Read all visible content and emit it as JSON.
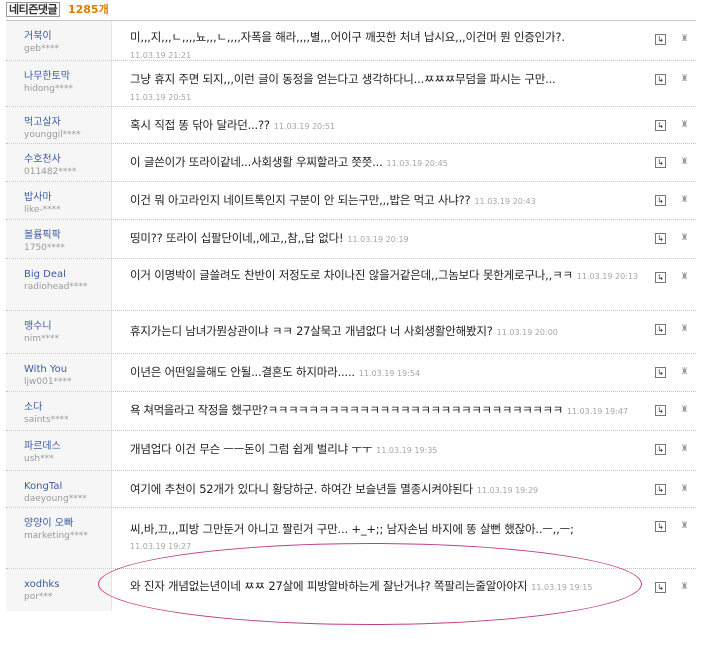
{
  "header": {
    "title": "네티즌댓글",
    "count": "1285개"
  },
  "icons": {
    "reply": "reply-arrow-icon",
    "report": "siren-bell-icon"
  },
  "colors": {
    "highlight_ellipse": "#c23d88",
    "count": "#e07b00",
    "nickname": "#3b5b9f"
  },
  "comments": [
    {
      "nick": "거북이",
      "id": "geb****",
      "text": "미,,,지,,,ㄴ,,,,뇨,,,ㄴ,,,,자폭을 해라,,,,별,,,어이구 깨끗한 처녀 납시요,,,이건머 뭔 인증인가?.",
      "date": "11.03.19 21:21"
    },
    {
      "nick": "나무한토막",
      "id": "hidong****",
      "text": "그냥 휴지 주면 되지,,,이런 글이 동정을 얻는다고 생각하다니...ㅉㅉㅉ무덤을 파시는 구만...",
      "date": "11.03.19 20:51"
    },
    {
      "nick": "먹고살자",
      "id": "younggil****",
      "text": "혹시 직접 똥 닦아 달라던...??",
      "date": "11.03.19 20:51"
    },
    {
      "nick": "수호천사",
      "id": "011482****",
      "text": "이 글쓴이가 또라이같네...사회생활 우찌할라고 쯧쯧...",
      "date": "11.03.19 20:45"
    },
    {
      "nick": "밥사마",
      "id": "like-****",
      "text": "이건 뭐 아고라인지 네이트톡인지 구분이 안 되는구만,,,밥은 먹고 사냐??",
      "date": "11.03.19 20:43"
    },
    {
      "nick": "볼륨픽팍",
      "id": "1750****",
      "text": "띵미?? 또라이 십팔단이네,,에고,,참,,답 없다!",
      "date": "11.03.19 20:19"
    },
    {
      "nick": "Big Deal",
      "id": "radiohead****",
      "text": "이거 이명박이 글쓸려도 찬반이 저정도로 차이나진 않을거같은데,,그놈보다 못한게로구나,,ㅋㅋ",
      "date": "11.03.19 20:13"
    },
    {
      "nick": "맹수니",
      "id": "nim****",
      "text": "휴지가는디 남녀가뭔상관이냐 ㅋㅋ 27살묵고 개념없다 너 사회생활안해봤지?",
      "date": "11.03.19 20:00"
    },
    {
      "nick": "With You",
      "id": "ljw001****",
      "text": "이년은 어떤일을해도 안될...결혼도 하지마라.....",
      "date": "11.03.19 19:54"
    },
    {
      "nick": "소다",
      "id": "saints****",
      "text": "욕 쳐먹을라고 작정을 했구만?ㅋㅋㅋㅋㅋㅋㅋㅋㅋㅋㅋㅋㅋㅋㅋㅋㅋㅋㅋㅋㅋㅋㅋㅋㅋㅋㅋㅋㅋ",
      "date": "11.03.19 19:47"
    },
    {
      "nick": "파르데스",
      "id": "ush***",
      "text": "개념업다 이건 무슨 ㅡㅡ돈이 그럼 쉽게 벌리냐 ㅜㅜ",
      "date": "11.03.19 19:35"
    },
    {
      "nick": "KongTal",
      "id": "daeyoung****",
      "text": "여기에 추천이 52개가 있다니 황당하군. 하여간 보슬년들 멸종시켜야된다",
      "date": "11.03.19 19:29"
    },
    {
      "nick": "양양이 오빠",
      "id": "marketing****",
      "text": "씨,바,끄,,,피방 그만둔거 아니고 짤린거 구만...  +_+;; 남자손님 바지에 똥 살뻔 했잖아..ㅡ,,ㅡ;",
      "date": "11.03.19 19:27"
    },
    {
      "nick": "xodhks",
      "id": "por***",
      "text": "와 진자 개념없는년이네 ㅉㅉ 27살에 피방알바하는게 잘난거냐? 쪽팔리는줄알아야지",
      "date": "11.03.19 19:15"
    }
  ]
}
